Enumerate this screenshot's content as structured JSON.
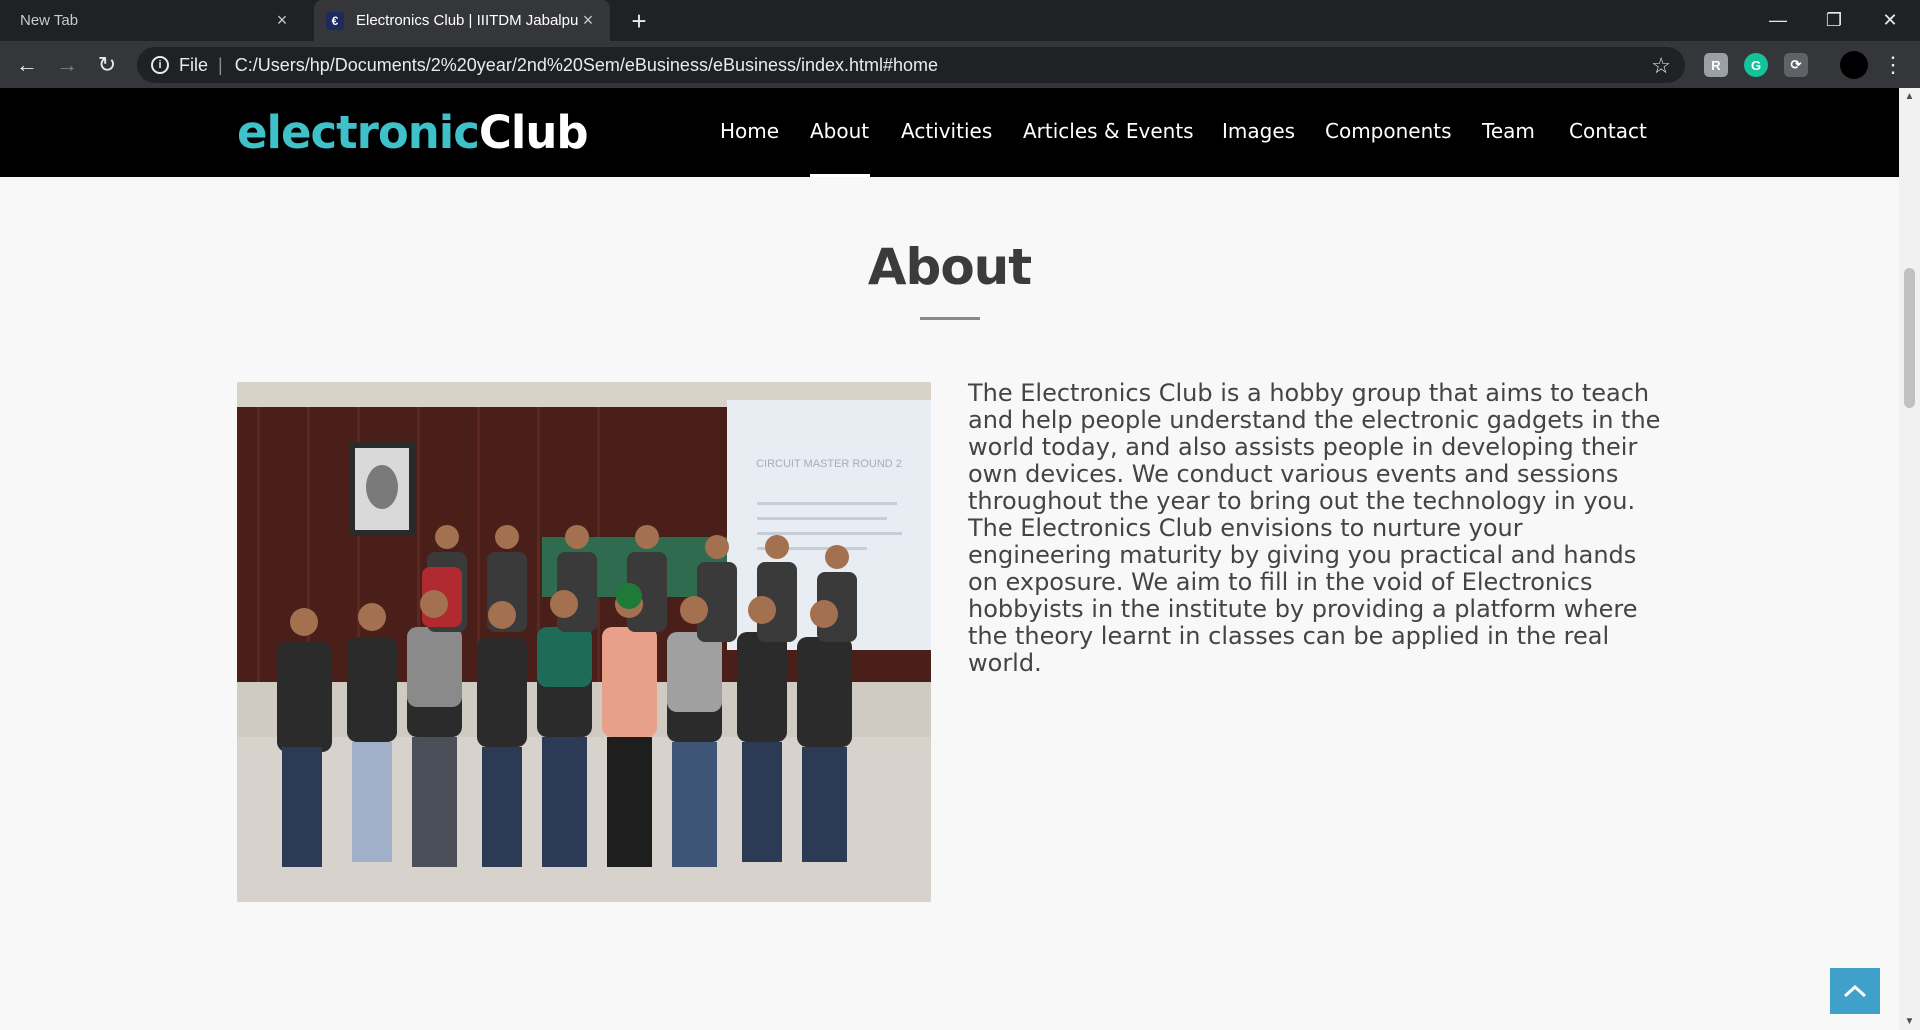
{
  "browser": {
    "tabs": [
      {
        "title": "New Tab",
        "active": false
      },
      {
        "title": "Electronics Club | IIITDM Jabalpur",
        "active": true
      }
    ],
    "new_tab_glyph": "+",
    "close_glyph": "×",
    "back_glyph": "←",
    "forward_glyph": "→",
    "reload_glyph": "↻",
    "info_glyph": "i",
    "scheme_label": "File",
    "separator": "|",
    "url": "C:/Users/hp/Documents/2%20year/2nd%20Sem/eBusiness/eBusiness/index.html#home",
    "star_glyph": "☆",
    "window_controls": {
      "minimize": "—",
      "restore": "❐",
      "close": "✕"
    },
    "extensions": [
      {
        "icon": "reader-extension-icon",
        "label": "R",
        "color": "#9aa0a6"
      },
      {
        "icon": "grammarly-icon",
        "label": "G",
        "color": "#15c39a"
      },
      {
        "icon": "screen-capture-icon",
        "label": "⟳",
        "color": "#5f6368"
      }
    ],
    "accent_color": "#35363a"
  },
  "site": {
    "logo_part1": "electronic",
    "logo_part2": "Club",
    "logo_accent": "#3fc1c9",
    "nav": [
      {
        "label": "Home",
        "active": false
      },
      {
        "label": "About",
        "active": true
      },
      {
        "label": "Activities",
        "active": false
      },
      {
        "label": "Articles & Events",
        "active": false
      },
      {
        "label": "Images",
        "active": false
      },
      {
        "label": "Components",
        "active": false
      },
      {
        "label": "Team",
        "active": false
      },
      {
        "label": "Contact",
        "active": false
      }
    ]
  },
  "about": {
    "title": "About",
    "body": "The Electronics Club is a hobby group that aims to teach and help people understand the electronic gadgets in the world today, and also assists people in developing their own devices. We conduct various events and sessions throughout the year to bring out the technology in you. The Electronics Club envisions to nurture your engineering maturity by giving you practical and hands on exposure. We aim to fill in the void of Electronics hobbyists in the institute by providing a platform where the theory learnt in classes can be applied in the real world.",
    "slide_heading": "CIRCUIT MASTER ROUND 2"
  },
  "scroll_top_glyph": "︿"
}
